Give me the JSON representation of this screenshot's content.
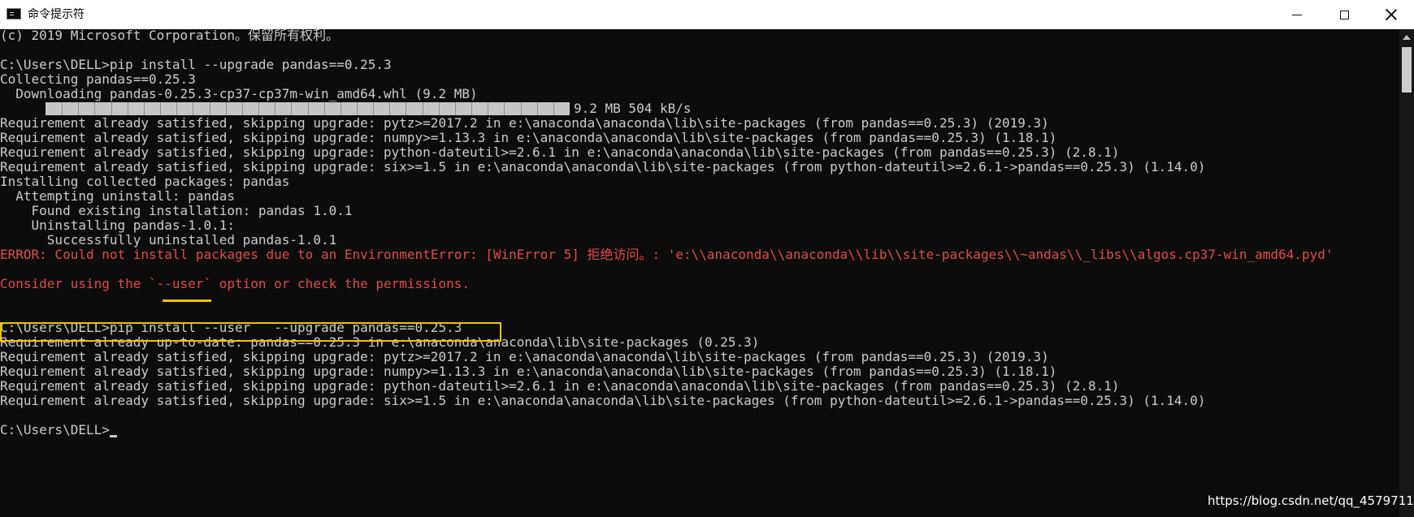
{
  "window": {
    "title": "命令提示符",
    "icons": {
      "app": "cmd-icon",
      "minimize": "minimize-icon",
      "maximize": "maximize-icon",
      "close": "close-icon"
    }
  },
  "console": {
    "lines": [
      "(c) 2019 Microsoft Corporation。保留所有权利。",
      "",
      "C:\\Users\\DELL>pip install --upgrade pandas==0.25.3",
      "Collecting pandas==0.25.3",
      "  Downloading pandas-0.25.3-cp37-cp37m-win_amd64.whl (9.2 MB)",
      "",
      "Requirement already satisfied, skipping upgrade: pytz>=2017.2 in e:\\anaconda\\anaconda\\lib\\site-packages (from pandas==0.25.3) (2019.3)",
      "Requirement already satisfied, skipping upgrade: numpy>=1.13.3 in e:\\anaconda\\anaconda\\lib\\site-packages (from pandas==0.25.3) (1.18.1)",
      "Requirement already satisfied, skipping upgrade: python-dateutil>=2.6.1 in e:\\anaconda\\anaconda\\lib\\site-packages (from pandas==0.25.3) (2.8.1)",
      "Requirement already satisfied, skipping upgrade: six>=1.5 in e:\\anaconda\\anaconda\\lib\\site-packages (from python-dateutil>=2.6.1->pandas==0.25.3) (1.14.0)",
      "Installing collected packages: pandas",
      "  Attempting uninstall: pandas",
      "    Found existing installation: pandas 1.0.1",
      "    Uninstalling pandas-1.0.1:",
      "      Successfully uninstalled pandas-1.0.1",
      "ERROR: Could not install packages due to an EnvironmentError: [WinError 5] 拒绝访问。: 'e:\\\\anaconda\\\\anaconda\\\\lib\\\\site-packages\\\\~andas\\\\_libs\\\\algos.cp37-win_amd64.pyd'",
      "",
      "Consider using the `--user` option or check the permissions.",
      "",
      "",
      "C:\\Users\\DELL>pip install --user   --upgrade pandas==0.25.3",
      "Requirement already up-to-date: pandas==0.25.3 in e:\\anaconda\\anaconda\\lib\\site-packages (0.25.3)",
      "Requirement already satisfied, skipping upgrade: pytz>=2017.2 in e:\\anaconda\\anaconda\\lib\\site-packages (from pandas==0.25.3) (2019.3)",
      "Requirement already satisfied, skipping upgrade: numpy>=1.13.3 in e:\\anaconda\\anaconda\\lib\\site-packages (from pandas==0.25.3) (1.18.1)",
      "Requirement already satisfied, skipping upgrade: python-dateutil>=2.6.1 in e:\\anaconda\\anaconda\\lib\\site-packages (from pandas==0.25.3) (2.8.1)",
      "Requirement already satisfied, skipping upgrade: six>=1.5 in e:\\anaconda\\anaconda\\lib\\site-packages (from python-dateutil>=2.6.1->pandas==0.25.3) (1.14.0)",
      "",
      "C:\\Users\\DELL>"
    ],
    "progress": {
      "fraction": 1.0,
      "text": "9.2 MB 504 kB/s"
    }
  },
  "watermark": "https://blog.csdn.net/qq_4579711",
  "colors": {
    "background": "#0c0c0c",
    "text": "#cccccc",
    "error": "#e34a4a",
    "highlight": "#f2c200",
    "titlebar": "#ffffff"
  }
}
